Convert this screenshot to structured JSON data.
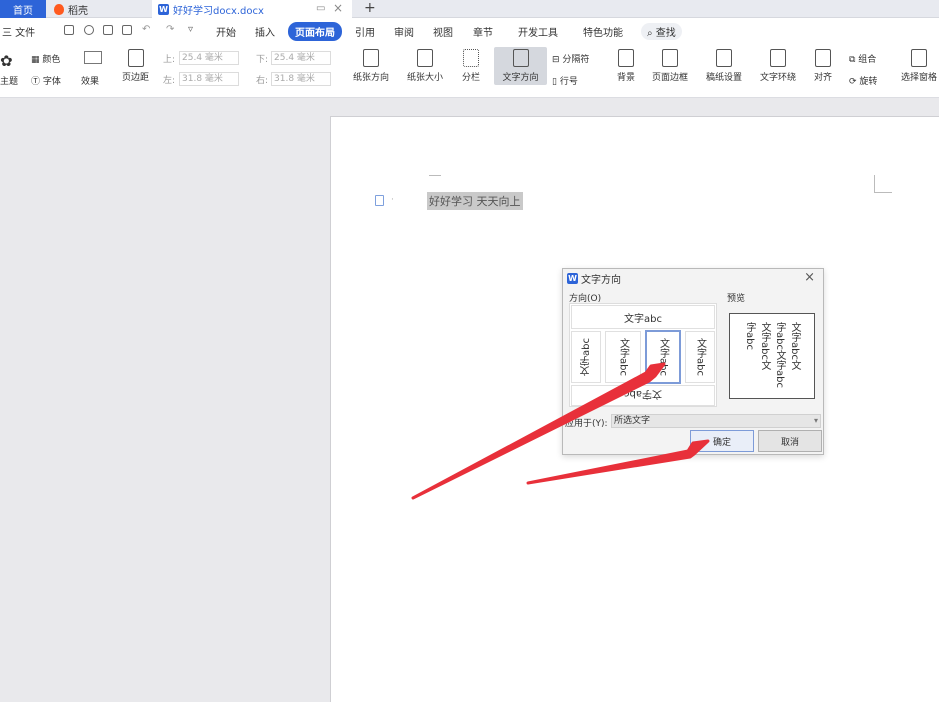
{
  "tabs": {
    "home": "首页",
    "daoke": "稻壳",
    "doc": "好好学习docx.docx",
    "add": "+"
  },
  "menu": {
    "file": "三 文件",
    "items": [
      "开始",
      "插入",
      "页面布局",
      "引用",
      "审阅",
      "视图",
      "章节",
      "开发工具",
      "特色功能"
    ],
    "active": "页面布局",
    "search": "查找"
  },
  "ribbon": {
    "theme": "主题",
    "color": "颜色",
    "font": "字体",
    "effect": "效果",
    "margins": "页边距",
    "top_label": "上:",
    "top_value": "25.4 毫米",
    "bottom_label": "下:",
    "bottom_value": "25.4 毫米",
    "left_label": "左:",
    "left_value": "31.8 毫米",
    "right_label": "右:",
    "right_value": "31.8 毫米",
    "orientation": "纸张方向",
    "size": "纸张大小",
    "columns": "分栏",
    "text_direction": "文字方向",
    "separator": "分隔符",
    "line_number": "行号",
    "background": "背景",
    "page_border": "页面边框",
    "grid_paper": "稿纸设置",
    "wrap": "文字环绕",
    "align": "对齐",
    "group": "组合",
    "rotate": "旋转",
    "select_pane": "选择窗格"
  },
  "document": {
    "text": "好好学习  天天向上"
  },
  "dialog": {
    "title": "文字方向",
    "close": "×",
    "direction_label": "方向(O)",
    "preview_label": "预览",
    "opt_horizontal": "文字abc",
    "opt_rotated": "文字abc",
    "opt_bottom": "文字abc",
    "preview_lines": [
      "文字abc文",
      "字abc文字abc",
      "文字abc文",
      "字abc"
    ],
    "apply_label": "应用于(Y):",
    "apply_value": "所选文字",
    "ok": "确定",
    "cancel": "取消"
  },
  "colors": {
    "accent": "#2d64d8",
    "arrow": "#e8303a"
  }
}
